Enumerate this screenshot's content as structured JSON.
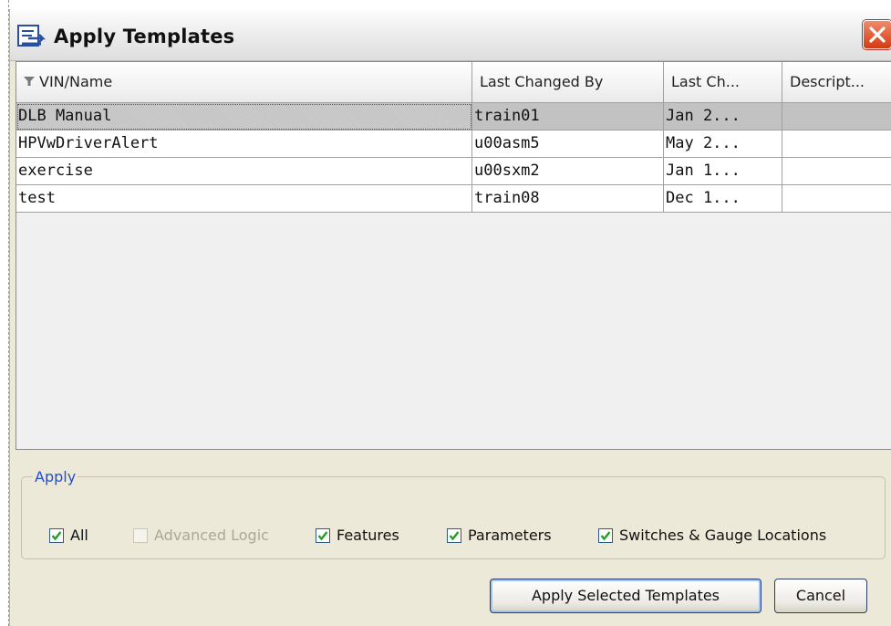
{
  "window": {
    "title": "Apply Templates",
    "title_icon": "templates-window-icon",
    "close_icon": "close-icon"
  },
  "grid": {
    "columns": [
      "VIN/Name",
      "Last Changed By",
      "Last Ch...",
      "Descript..."
    ],
    "filter_icon": "filter-icon",
    "rows": [
      {
        "name": "DLB Manual",
        "changed_by": "train01",
        "changed": "Jan 2...",
        "desc": ""
      },
      {
        "name": "HPVwDriverAlert",
        "changed_by": "u00asm5",
        "changed": "May 2...",
        "desc": ""
      },
      {
        "name": "exercise",
        "changed_by": "u00sxm2",
        "changed": "Jan 1...",
        "desc": ""
      },
      {
        "name": "test",
        "changed_by": "train08",
        "changed": "Dec 1...",
        "desc": ""
      }
    ],
    "selected_row": 0
  },
  "apply": {
    "legend": "Apply",
    "options": [
      {
        "label": "All",
        "checked": true,
        "enabled": true
      },
      {
        "label": "Advanced Logic",
        "checked": false,
        "enabled": false
      },
      {
        "label": "Features",
        "checked": true,
        "enabled": true
      },
      {
        "label": "Parameters",
        "checked": true,
        "enabled": true
      },
      {
        "label": "Switches & Gauge Locations",
        "checked": true,
        "enabled": true
      }
    ]
  },
  "buttons": {
    "apply_selected": "Apply Selected Templates",
    "cancel": "Cancel"
  },
  "colors": {
    "legend_blue": "#1f4fd6",
    "check_green": "#21a121",
    "close_red": "#d43a12",
    "selected_row": "#c2c2c2"
  }
}
